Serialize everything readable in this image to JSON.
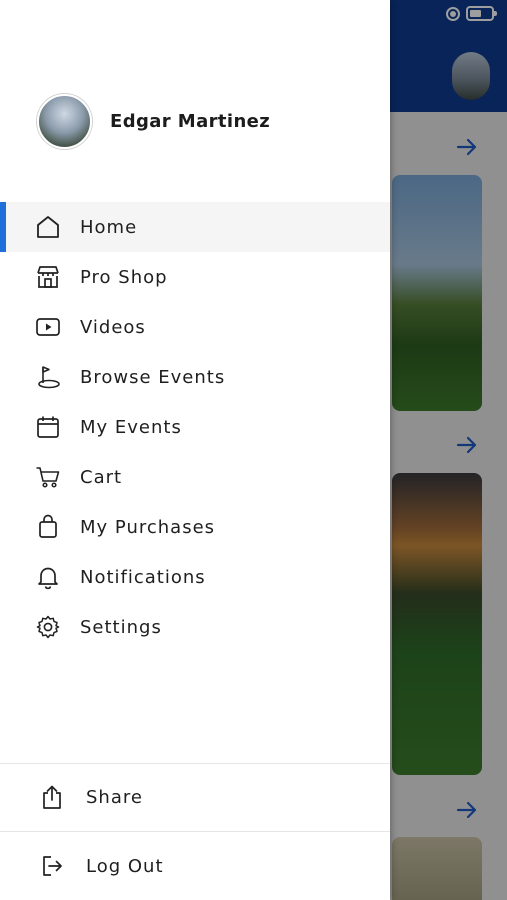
{
  "status_bar": {
    "battery_level": 0.55,
    "orientation_icon": "rotation-lock-icon"
  },
  "profile": {
    "name": "Edgar Martinez"
  },
  "menu": [
    {
      "label": "Home",
      "icon": "home-icon",
      "active": true
    },
    {
      "label": "Pro Shop",
      "icon": "store-icon",
      "active": false
    },
    {
      "label": "Videos",
      "icon": "video-play-icon",
      "active": false
    },
    {
      "label": "Browse Events",
      "icon": "golf-flag-icon",
      "active": false
    },
    {
      "label": "My Events",
      "icon": "calendar-icon",
      "active": false
    },
    {
      "label": "Cart",
      "icon": "cart-icon",
      "active": false
    },
    {
      "label": "My Purchases",
      "icon": "shopping-bag-icon",
      "active": false
    },
    {
      "label": "Notifications",
      "icon": "bell-icon",
      "active": false
    },
    {
      "label": "Settings",
      "icon": "gear-icon",
      "active": false
    }
  ],
  "bottom": {
    "share": {
      "label": "Share",
      "icon": "share-icon"
    },
    "logout": {
      "label": "Log Out",
      "icon": "logout-icon"
    }
  },
  "colors": {
    "accent": "#1f6fdb",
    "header_blue": "#0d3b8e",
    "active_bg": "#f5f5f5"
  }
}
